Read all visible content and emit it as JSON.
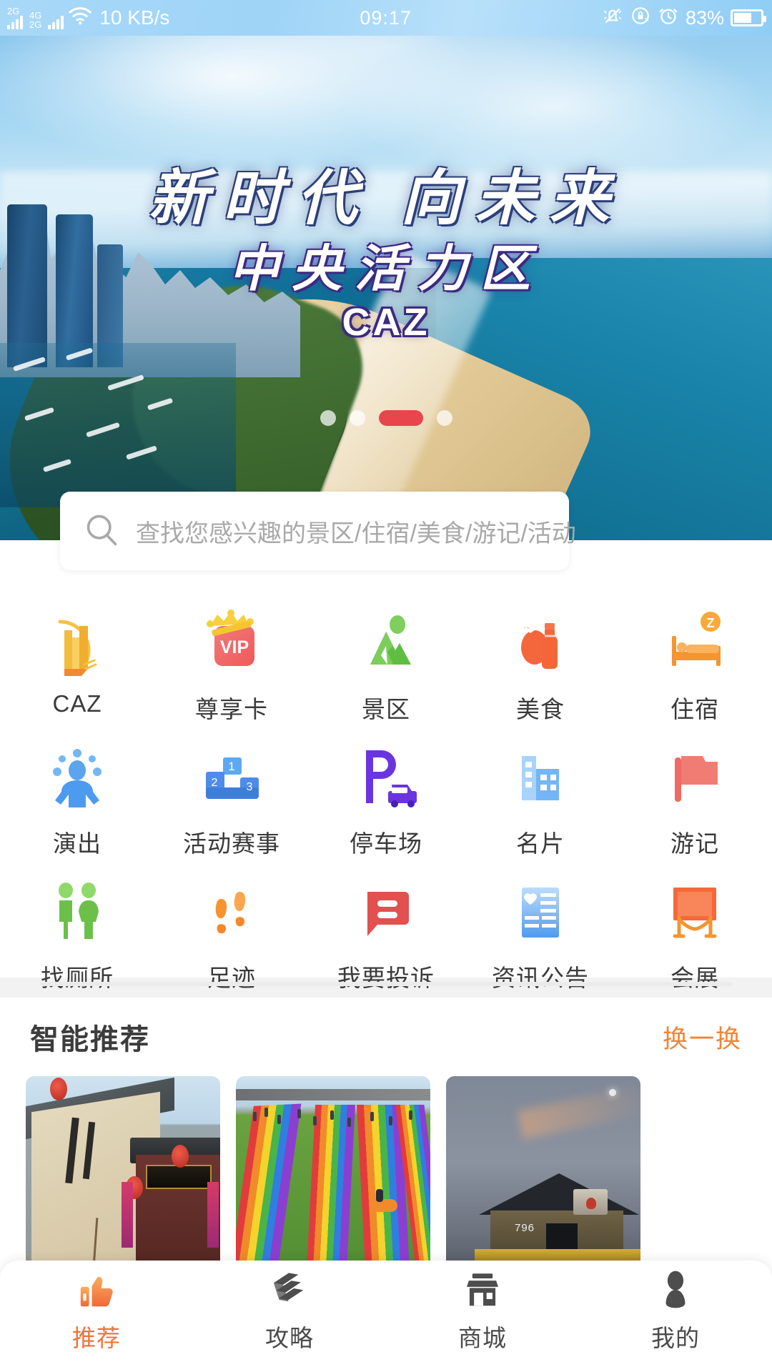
{
  "status_bar": {
    "network_tag_top": "2G",
    "network_tag_top2": "4G",
    "network_tag_bottom": "2G",
    "wifi_icon": "wifi-icon",
    "network_speed": "10 KB/s",
    "time": "09:17",
    "silent_icon": "bell-muted-icon",
    "rotation_lock_icon": "rotation-lock-icon",
    "alarm_icon": "alarm-clock-icon",
    "battery_percent": "83%",
    "battery_icon": "battery-icon"
  },
  "banner": {
    "title_main": "新时代 向未来",
    "title_sub": "中央活力区",
    "title_caz": "CAZ",
    "dots_total": 4,
    "dot_active_index": 2,
    "active_dot_color": "#e8454d"
  },
  "search": {
    "icon": "search-icon",
    "placeholder": "查找您感兴趣的景区/住宿/美食/游记/活动",
    "value": ""
  },
  "grid": {
    "items": [
      {
        "label": "CAZ",
        "icon": "building-caz-icon",
        "color": "#f5b731"
      },
      {
        "label": "尊享卡",
        "icon": "vip-card-icon",
        "color": "#ef5350"
      },
      {
        "label": "景区",
        "icon": "mountain-icon",
        "color": "#6cc04a"
      },
      {
        "label": "美食",
        "icon": "food-bottle-icon",
        "color": "#f4663a"
      },
      {
        "label": "住宿",
        "icon": "bed-sleep-icon",
        "color": "#f5952e"
      },
      {
        "label": "演出",
        "icon": "performer-icon",
        "color": "#4d9bee"
      },
      {
        "label": "活动赛事",
        "icon": "podium-icon",
        "color": "#4d8ce8"
      },
      {
        "label": "停车场",
        "icon": "parking-car-icon",
        "color": "#6a35e0"
      },
      {
        "label": "名片",
        "icon": "business-card-icon",
        "color": "#7dbcf5"
      },
      {
        "label": "游记",
        "icon": "flag-icon",
        "color": "#ef6a62"
      },
      {
        "label": "找厕所",
        "icon": "restroom-icon",
        "color": "#72c94a"
      },
      {
        "label": "足迹",
        "icon": "footprints-icon",
        "color": "#f59430"
      },
      {
        "label": "我要投诉",
        "icon": "complaint-chat-icon",
        "color": "#e2504f"
      },
      {
        "label": "资讯公告",
        "icon": "news-list-icon",
        "color": "#59a5f0"
      },
      {
        "label": "会展",
        "icon": "exhibition-icon",
        "color": "#f4683a"
      }
    ]
  },
  "recommend": {
    "title": "智能推荐",
    "refresh_label": "换一换",
    "refresh_color": "#f28434",
    "cards": [
      {
        "name": "courtyard-inn-photo",
        "alt": "传统四合院客栈门楼，红灯笼与春联"
      },
      {
        "name": "rainbow-slide-photo",
        "alt": "彩虹滑道草坪乐园"
      },
      {
        "name": "night-inn-photo",
        "alt": "夜景客栈牌楼灯饰"
      }
    ]
  },
  "tab_bar": {
    "active_color": "#f0733a",
    "items": [
      {
        "label": "推荐",
        "icon": "thumbs-up-icon",
        "active": true
      },
      {
        "label": "攻略",
        "icon": "book-icon",
        "active": false
      },
      {
        "label": "商城",
        "icon": "store-icon",
        "active": false
      },
      {
        "label": "我的",
        "icon": "person-icon",
        "active": false
      }
    ]
  }
}
